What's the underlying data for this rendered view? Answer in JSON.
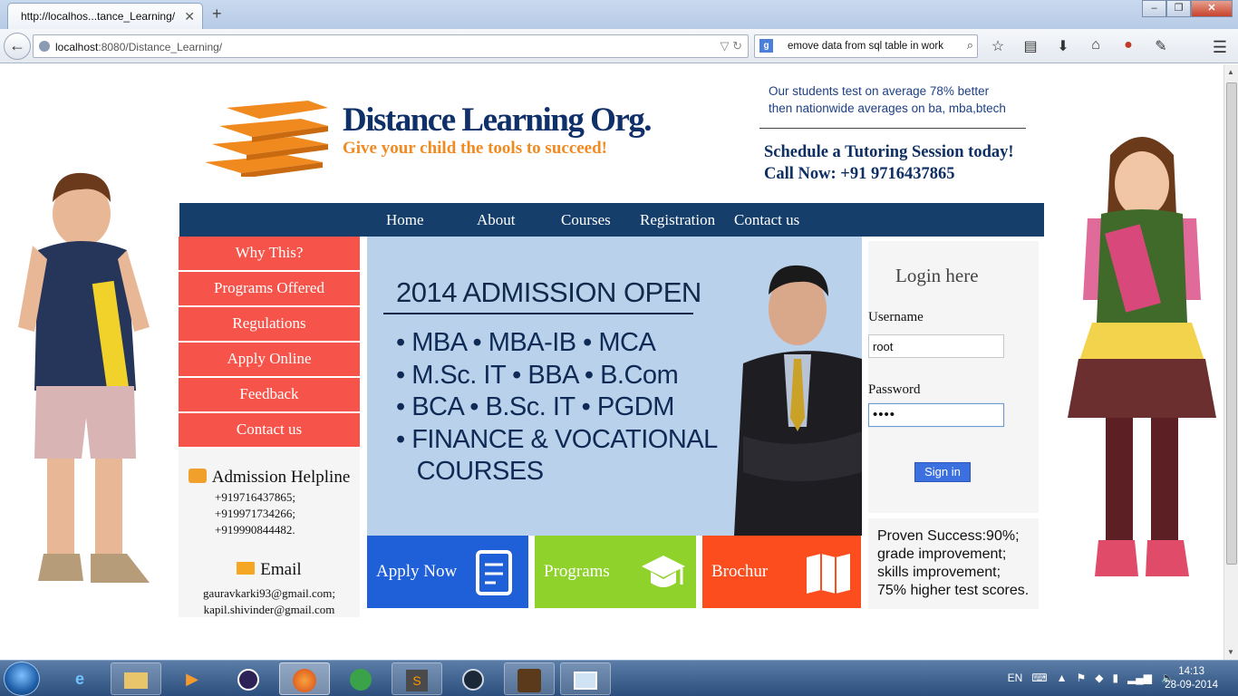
{
  "browser": {
    "tab_title": "http://localhos...tance_Learning/",
    "tab_close": "✕",
    "new_tab": "+",
    "win_minimize": "–",
    "win_maximize": "❐",
    "win_close": "✕",
    "url_host": "localhost",
    "url_rest": ":8080/Distance_Learning/",
    "search_text": "emove data from   sql table in work",
    "search_engine": "g",
    "back": "←"
  },
  "header": {
    "brand_title": "Distance Learning Org.",
    "brand_tagline": "Give your child the tools to succeed!",
    "promo_line1": "Our students test on average 78% better",
    "promo_line2": "then nationwide averages on ba, mba,btech",
    "cta_line1": "Schedule a Tutoring Session today!",
    "cta_line2": "Call Now: +91 9716437865"
  },
  "nav": {
    "home": "Home",
    "about": "About",
    "courses": "Courses",
    "registration": "Registration",
    "contact": "Contact us"
  },
  "sidebar": {
    "items": [
      "Why This?",
      "Programs Offered",
      "Regulations",
      "Apply Online",
      "Feedback",
      "Contact us"
    ],
    "helpline_title": "Admission Helpline",
    "phones": [
      "+919716437865;",
      "+919971734266;",
      "+919990844482."
    ],
    "email_title": "Email",
    "emails": [
      "gauravkarki93@gmail.com;",
      "kapil.shivinder@gmail.com"
    ]
  },
  "banner": {
    "heading": "2014 ADMISSION OPEN",
    "lines": [
      "• MBA • MBA-IB • MCA",
      "• M.Sc. IT • BBA • B.Com",
      "• BCA • B.Sc. IT • PGDM",
      "• FINANCE & VOCATIONAL",
      "   COURSES"
    ]
  },
  "tiles": {
    "apply": "Apply Now",
    "programs": "Programs",
    "brochure": "Brochur"
  },
  "login": {
    "title": "Login here",
    "username_label": "Username",
    "username_value": "root",
    "password_label": "Password",
    "password_value": "••••",
    "signin_label": "Sign in"
  },
  "proven": [
    "Proven Success:90%;",
    "grade improvement;",
    "skills improvement;",
    "75% higher test scores."
  ],
  "taskbar": {
    "lang": "EN",
    "time": "14:13",
    "date": "28-09-2014"
  },
  "colors": {
    "nav_bg": "#153e6b",
    "side_item": "#f6544a",
    "tile_apply": "#1f5fd8",
    "tile_programs": "#8fd22b",
    "tile_brochure": "#fb4d1d",
    "brand_title": "#10306a",
    "brand_tagline": "#f28a22"
  }
}
